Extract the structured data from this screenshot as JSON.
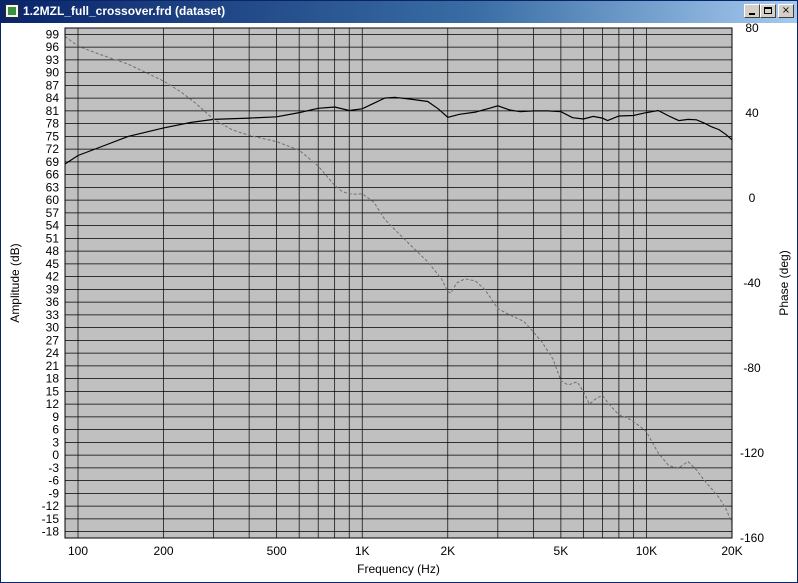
{
  "window": {
    "title": "1.2MZL_full_crossover.frd (dataset)",
    "close_glyph": "×"
  },
  "chart_data": {
    "type": "line",
    "xlabel": "Frequency (Hz)",
    "ylabel": "Amplitude (dB)",
    "y2label": "Phase (deg)",
    "x_scale": "log",
    "xlim": [
      90,
      20000
    ],
    "ylim": [
      -19.5,
      100.5
    ],
    "y2lim": [
      -160,
      80
    ],
    "x_ticks": [
      {
        "value": 100,
        "label": "100"
      },
      {
        "value": 200,
        "label": "200"
      },
      {
        "value": 500,
        "label": "500"
      },
      {
        "value": 1000,
        "label": "1K"
      },
      {
        "value": 2000,
        "label": "2K"
      },
      {
        "value": 5000,
        "label": "5K"
      },
      {
        "value": 10000,
        "label": "10K"
      },
      {
        "value": 20000,
        "label": "20K"
      }
    ],
    "y_ticks": [
      99,
      96,
      93,
      90,
      87,
      84,
      81,
      78,
      75,
      72,
      69,
      66,
      63,
      60,
      57,
      54,
      51,
      48,
      45,
      42,
      39,
      36,
      33,
      30,
      27,
      24,
      21,
      18,
      15,
      12,
      9,
      6,
      3,
      0,
      -3,
      -6,
      -9,
      -12,
      -15,
      -18
    ],
    "y2_ticks": [
      80,
      40,
      0,
      -40,
      -80,
      -120,
      -160
    ],
    "grid": true,
    "background_color": "#c0c0c0",
    "series": [
      {
        "style": "solid",
        "axis": "left",
        "color": "#000000",
        "x": [
          90,
          100,
          120,
          150,
          200,
          250,
          300,
          400,
          500,
          600,
          700,
          800,
          900,
          1000,
          1100,
          1200,
          1300,
          1500,
          1700,
          1850,
          2000,
          2200,
          2500,
          2800,
          3000,
          3300,
          3600,
          4000,
          4500,
          5000,
          5500,
          6000,
          6500,
          7000,
          7300,
          8000,
          9000,
          10000,
          11000,
          12000,
          13000,
          14000,
          15000,
          16000,
          17000,
          18000,
          19000,
          20000
        ],
        "values": [
          68.5,
          70.5,
          72.5,
          75,
          77,
          78.3,
          79,
          79.3,
          79.6,
          80.6,
          81.6,
          81.9,
          81.1,
          81.5,
          82.8,
          84,
          84.2,
          83.7,
          83.2,
          81.5,
          79.5,
          80.2,
          80.7,
          81.6,
          82.2,
          81.2,
          80.8,
          81,
          81,
          80.8,
          79.4,
          79.1,
          79.7,
          79.3,
          78.7,
          79.8,
          79.9,
          80.6,
          81.1,
          79.8,
          78.7,
          79,
          78.9,
          78.1,
          77.2,
          76.6,
          75.5,
          74.2
        ]
      },
      {
        "style": "dashed",
        "axis": "right",
        "color": "#707070",
        "x": [
          90,
          100,
          120,
          150,
          180,
          200,
          230,
          260,
          300,
          350,
          400,
          500,
          600,
          700,
          800,
          850,
          900,
          950,
          1000,
          1100,
          1200,
          1350,
          1500,
          1700,
          1900,
          2000,
          2050,
          2150,
          2300,
          2500,
          2700,
          3000,
          3300,
          3700,
          4000,
          4300,
          4700,
          5000,
          5300,
          5700,
          6000,
          6300,
          6700,
          7000,
          7500,
          8000,
          8700,
          9400,
          10000,
          11000,
          12000,
          13000,
          14000,
          15000,
          16000,
          17000,
          18000,
          19000,
          20000
        ],
        "values": [
          76,
          71.5,
          67.5,
          63,
          58,
          55,
          50,
          44.5,
          37,
          32,
          29.5,
          26.5,
          22.5,
          15,
          6,
          3,
          2,
          1.8,
          2,
          -2,
          -10,
          -17,
          -23,
          -30,
          -38,
          -44,
          -44.8,
          -40,
          -38,
          -39,
          -43,
          -52,
          -55,
          -58,
          -63,
          -68,
          -76,
          -86,
          -88,
          -86.5,
          -91,
          -97,
          -94,
          -93,
          -98,
          -102,
          -104,
          -107,
          -110,
          -120,
          -126,
          -127,
          -124,
          -128,
          -133,
          -137,
          -141,
          -146,
          -153
        ]
      }
    ]
  }
}
